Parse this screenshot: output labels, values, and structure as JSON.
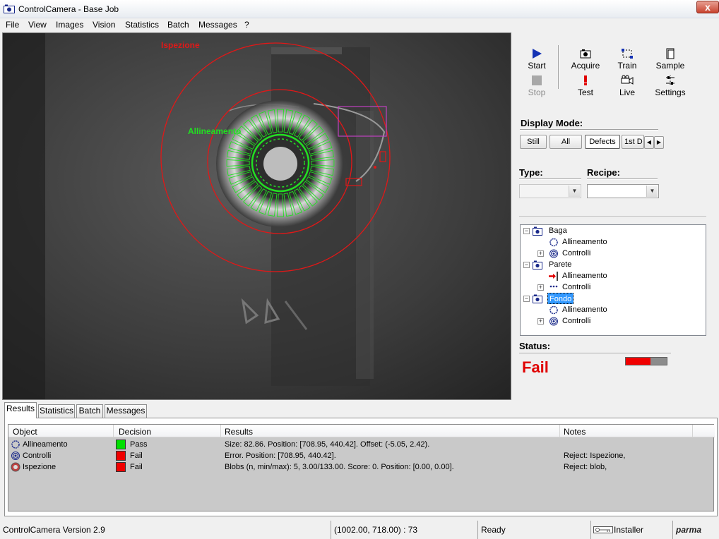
{
  "window": {
    "title": "ControlCamera - Base Job",
    "close_label": "x"
  },
  "menu": [
    "File",
    "View",
    "Images",
    "Vision",
    "Statistics",
    "Batch",
    "Messages",
    "?"
  ],
  "viewer": {
    "overlay_inspection": "Ispezione",
    "overlay_alignment": "Allineamento",
    "colors": {
      "inspection": "#e01818",
      "alignment": "#22e022",
      "roi": "#c040c0"
    }
  },
  "toolbar": {
    "start": "Start",
    "stop": "Stop",
    "acquire": "Acquire",
    "test": "Test",
    "train": "Train",
    "live": "Live",
    "sample": "Sample",
    "settings": "Settings"
  },
  "display_mode": {
    "label": "Display Mode:",
    "buttons": [
      "Still",
      "All",
      "Defects",
      "1st D"
    ],
    "selected": "Defects"
  },
  "type": {
    "label": "Type:",
    "value": ""
  },
  "recipe": {
    "label": "Recipe:",
    "value": ""
  },
  "tree": [
    {
      "label": "Baga",
      "children": [
        "Allineamento",
        "Controlli"
      ]
    },
    {
      "label": "Parete",
      "children": [
        "Allineamento",
        "Controlli"
      ]
    },
    {
      "label": "Fondo",
      "children": [
        "Allineamento",
        "Controlli"
      ]
    }
  ],
  "status": {
    "label": "Status:",
    "value": "Fail",
    "progress_fail": 0.6
  },
  "tabs": [
    "Results",
    "Statistics",
    "Batch",
    "Messages"
  ],
  "results": {
    "headers": [
      "Object",
      "Decision",
      "Results",
      "Notes"
    ],
    "rows": [
      {
        "object": "Allineamento",
        "decision": "Pass",
        "color": "#00e000",
        "results": "Size: 82.86. Position: [708.95, 440.42]. Offset: (-5.05, 2.42).",
        "notes": ""
      },
      {
        "object": "Controlli",
        "decision": "Fail",
        "color": "#f00000",
        "results": "Error. Position: [708.95, 440.42].",
        "notes": "Reject: Ispezione,"
      },
      {
        "object": "Ispezione",
        "decision": "Fail",
        "color": "#f00000",
        "results": "Blobs (n, min/max): 5, 3.00/133.00. Score: 0. Position: [0.00, 0.00].",
        "notes": "Reject: blob,"
      }
    ]
  },
  "statusbar": {
    "version": "ControlCamera Version 2.9",
    "coords": "(1002.00, 718.00) : 73",
    "state": "Ready",
    "user": "Installer",
    "logo": "parma"
  }
}
